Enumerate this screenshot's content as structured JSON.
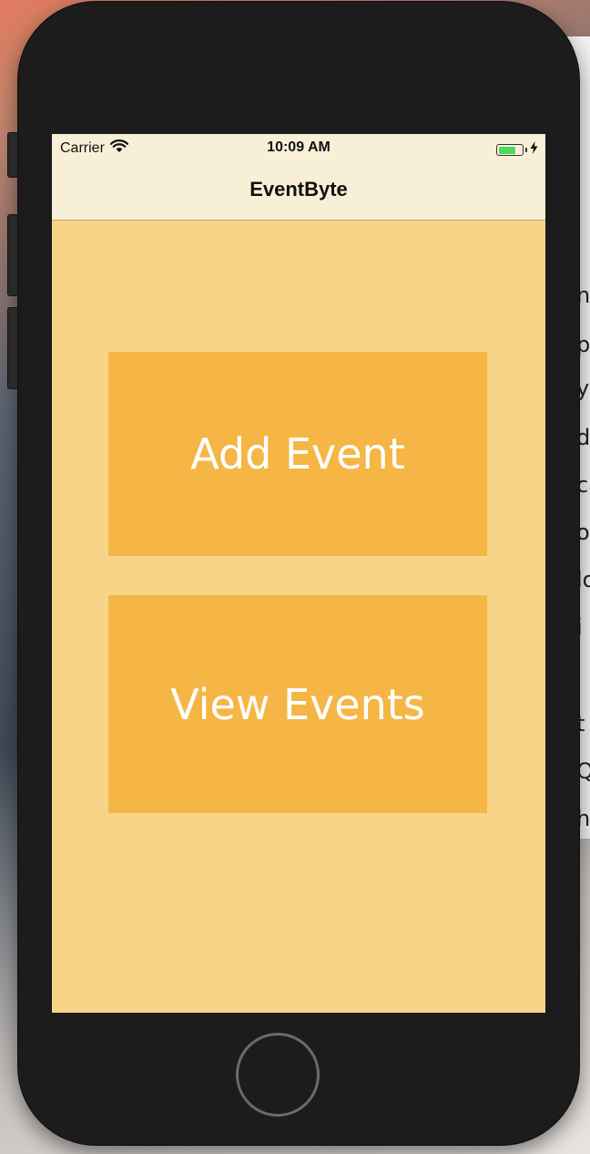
{
  "status_bar": {
    "carrier": "Carrier",
    "time": "10:09 AM",
    "battery_level": 0.75
  },
  "nav_bar": {
    "title": "EventByte"
  },
  "main": {
    "add_event_label": "Add Event",
    "view_events_label": "View Events"
  },
  "background_window": {
    "fragments": [
      "n",
      "p",
      "y",
      "d",
      "ca",
      "o",
      "lo",
      "i",
      "t",
      "Q",
      "h"
    ]
  },
  "colors": {
    "screen_background": "#f8d488",
    "button_background": "#f5b645",
    "button_text": "#ffffff",
    "nav_background": "#f8f0d6",
    "battery_green": "#4cd964"
  }
}
